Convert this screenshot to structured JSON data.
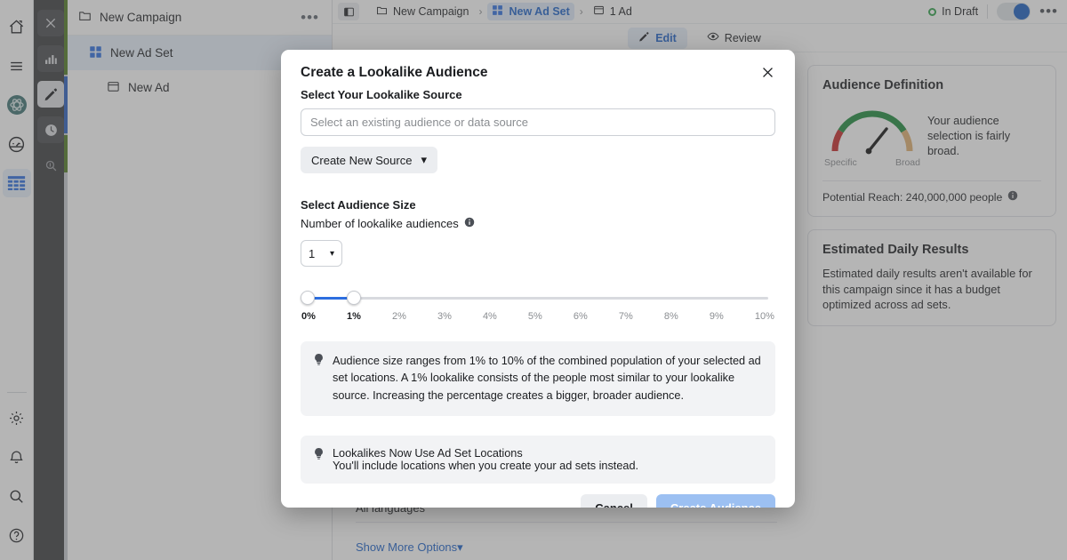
{
  "rail_outer": {
    "items": [
      {
        "name": "home-icon",
        "label": "Home"
      },
      {
        "name": "menu-icon",
        "label": "Menu"
      },
      {
        "name": "brand-logo-icon",
        "label": "Brand"
      },
      {
        "name": "dashboard-icon",
        "label": "Dashboard"
      },
      {
        "name": "table-icon",
        "label": "Campaigns"
      }
    ],
    "bottom": [
      {
        "name": "gear-icon",
        "label": "Settings"
      },
      {
        "name": "bell-icon",
        "label": "Notifications"
      },
      {
        "name": "search-icon",
        "label": "Search"
      },
      {
        "name": "help-icon",
        "label": "Help"
      }
    ]
  },
  "rail_dark": {
    "items": [
      {
        "name": "close-icon",
        "label": "Close"
      },
      {
        "name": "bar-chart-icon",
        "label": "Charts"
      },
      {
        "name": "pencil-icon",
        "label": "Edit"
      },
      {
        "name": "clock-icon",
        "label": "History"
      },
      {
        "name": "search-icon",
        "label": "Search"
      }
    ]
  },
  "tree": {
    "header": {
      "label": "New Campaign",
      "more": "•••"
    },
    "rows": [
      {
        "label": "New Ad Set",
        "icon": "grid-icon",
        "selected": true
      },
      {
        "label": "New Ad",
        "icon": "ad-icon",
        "selected": false
      }
    ]
  },
  "topbar": {
    "breadcrumb": [
      {
        "label": "New Campaign",
        "icon": "folder-icon",
        "selected": false
      },
      {
        "label": "New Ad Set",
        "icon": "grid-icon",
        "selected": true
      },
      {
        "label": "1 Ad",
        "icon": "ad-icon",
        "selected": false
      }
    ],
    "separator": "›",
    "status": "In Draft",
    "kebab": "•••"
  },
  "tabs": [
    {
      "label": "Edit",
      "icon": "pencil-icon",
      "active": true
    },
    {
      "label": "Review",
      "icon": "eye-icon",
      "active": false
    }
  ],
  "form_behind": {
    "languages": "All languages",
    "show_more": "Show More Options",
    "show_more_caret": "▾"
  },
  "right_panel": {
    "audience_definition": {
      "title": "Audience Definition",
      "gauge_left_label": "Specific",
      "gauge_right_label": "Broad",
      "note": "Your audience selection is fairly broad.",
      "reach": "Potential Reach: 240,000,000 people"
    },
    "estimated_daily_results": {
      "title": "Estimated Daily Results",
      "body": "Estimated daily results aren't available for this campaign since it has a budget optimized across ad sets."
    }
  },
  "modal": {
    "title": "Create a Lookalike Audience",
    "source_label": "Select Your Lookalike Source",
    "source_placeholder": "Select an existing audience or data source",
    "source_value": "",
    "create_source_button": "Create New Source",
    "create_source_caret": "▾",
    "size_label": "Select Audience Size",
    "count_label": "Number of lookalike audiences",
    "count_value": "1",
    "count_caret": "▾",
    "slider": {
      "min": 0,
      "max": 10,
      "lower_value": 0,
      "upper_value": 1,
      "ticks": [
        "0%",
        "1%",
        "2%",
        "3%",
        "4%",
        "5%",
        "6%",
        "7%",
        "8%",
        "9%",
        "10%"
      ],
      "active_ticks": [
        "0%",
        "1%"
      ]
    },
    "tip1": "Audience size ranges from 1% to 10% of the combined population of your selected ad set locations. A 1% lookalike consists of the people most similar to your lookalike source. Increasing the percentage creates a bigger, broader audience.",
    "tip2_title": "Lookalikes Now Use Ad Set Locations",
    "tip2_body": "You'll include locations when you create your ad sets instead.",
    "cancel": "Cancel",
    "submit": "Create Audience"
  },
  "colors": {
    "accent_blue": "#1d62c9",
    "slider_blue": "#2d6ee0",
    "primary_disabled": "#9cc0f2",
    "status_green": "#31a24c",
    "gauge_red": "#c62828",
    "gauge_green": "#1e8a3c",
    "gauge_tan": "#e0b070"
  }
}
